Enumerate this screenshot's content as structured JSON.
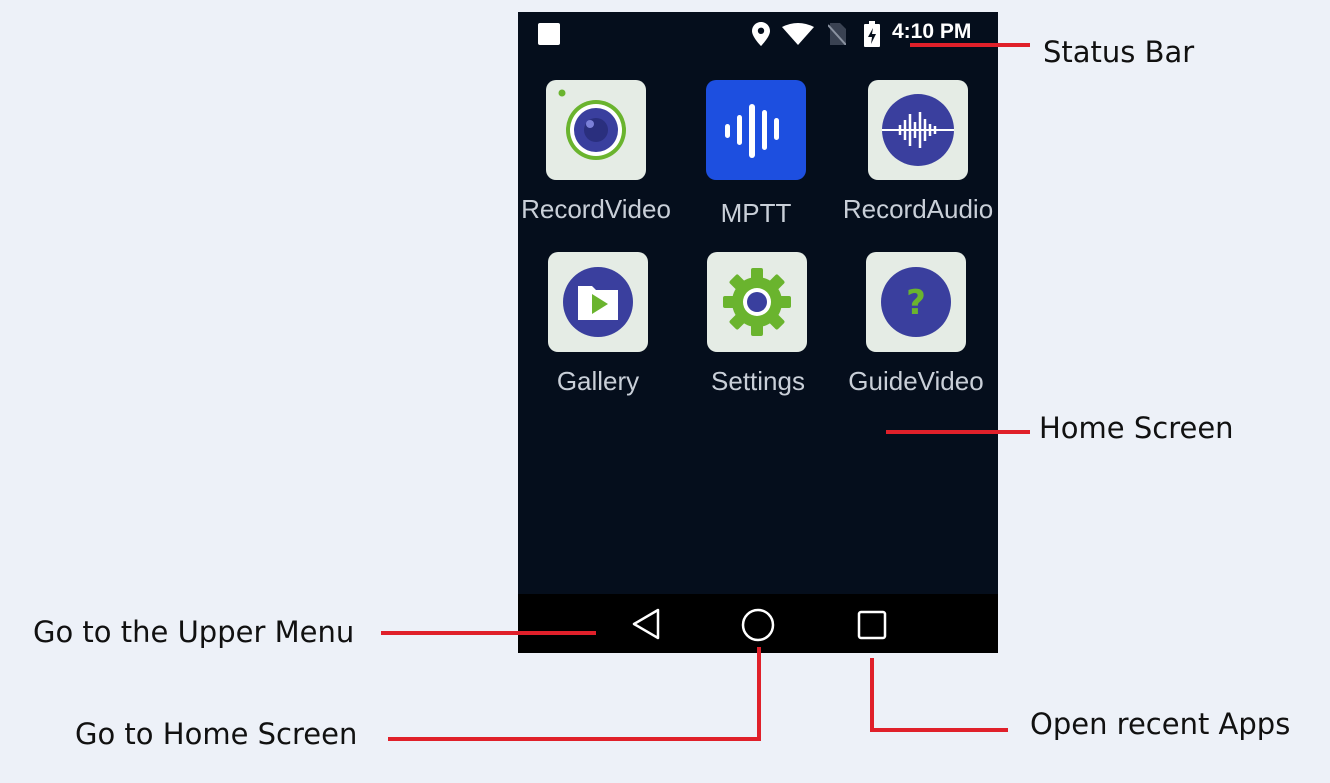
{
  "status_bar": {
    "time": "4:10 PM"
  },
  "apps": [
    {
      "label": "RecordVideo",
      "icon": "camera-icon"
    },
    {
      "label": "MPTT",
      "icon": "audio-bars-icon"
    },
    {
      "label": "RecordAudio",
      "icon": "waveform-icon"
    },
    {
      "label": "Gallery",
      "icon": "play-folder-icon"
    },
    {
      "label": "Settings",
      "icon": "gear-icon"
    },
    {
      "label": "GuideVideo",
      "icon": "question-icon"
    }
  ],
  "navigation": {
    "back_icon": "back-triangle-icon",
    "home_icon": "home-circle-icon",
    "recents_icon": "recents-square-icon"
  },
  "annotations": {
    "status_bar": "Status Bar",
    "home_screen": "Home Screen",
    "upper_menu": "Go to the Upper Menu",
    "home": "Go to Home Screen",
    "recent_apps": "Open recent Apps"
  },
  "colors": {
    "screen_background": "#050e1c",
    "annotation_line": "#e0202a",
    "page_background": "#edf1f8",
    "tile_background": "#e5ece5",
    "icon_purple": "#3a3f9e",
    "icon_green": "#6ab42e",
    "mptt_blue": "#1d4fe0"
  }
}
